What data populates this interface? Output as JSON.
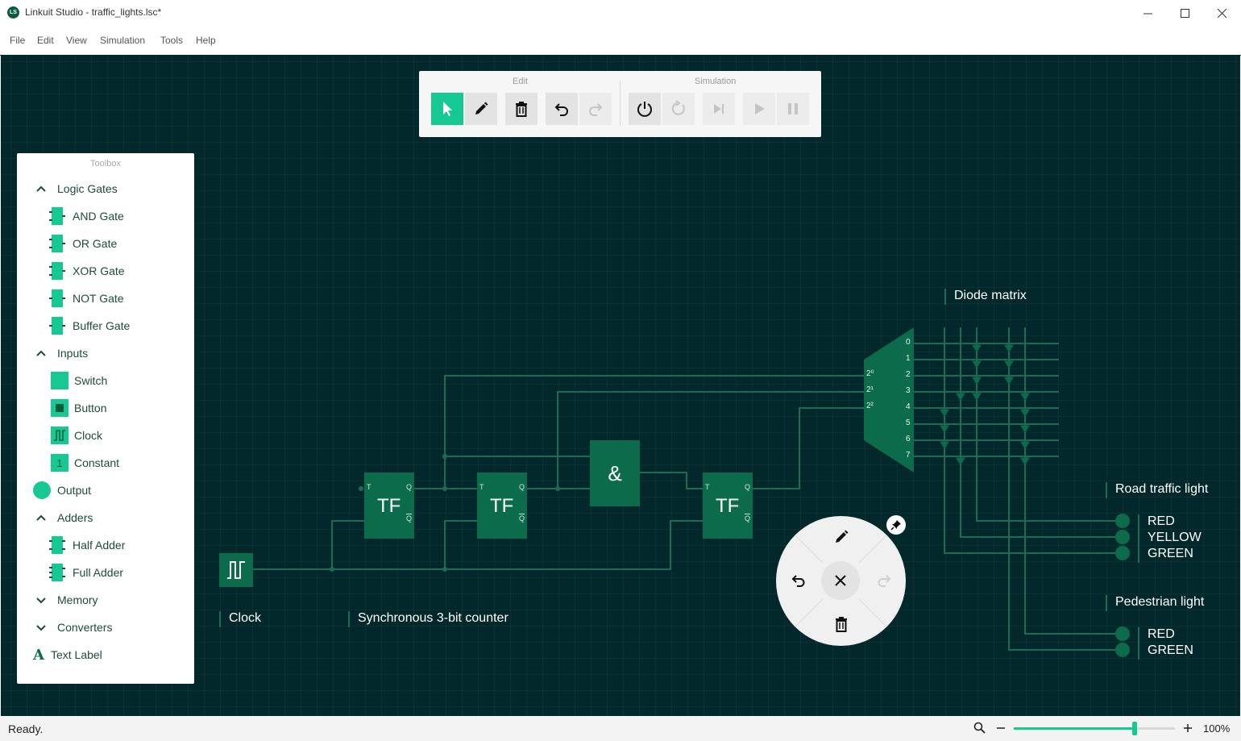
{
  "window": {
    "app_icon": "LS",
    "title": "Linkuit Studio - traffic_lights.lsc*"
  },
  "menu": [
    "File",
    "Edit",
    "View",
    "Simulation",
    "Tools",
    "Help"
  ],
  "toolbar": {
    "edit_label": "Edit",
    "simulation_label": "Simulation",
    "edit_buttons": [
      {
        "name": "select-tool-button",
        "icon": "cursor-arrow-icon",
        "state": "active"
      },
      {
        "name": "wire-tool-button",
        "icon": "pencil-icon",
        "state": "normal"
      },
      {
        "name": "delete-button",
        "icon": "trash-icon",
        "state": "normal"
      },
      {
        "name": "undo-button",
        "icon": "undo-icon",
        "state": "normal"
      },
      {
        "name": "redo-button",
        "icon": "redo-icon",
        "state": "disabled"
      }
    ],
    "simulation_buttons": [
      {
        "name": "power-button",
        "icon": "power-icon",
        "state": "normal"
      },
      {
        "name": "reset-button",
        "icon": "reset-icon",
        "state": "disabled"
      },
      {
        "name": "step-button",
        "icon": "step-icon",
        "state": "disabled"
      },
      {
        "name": "run-button",
        "icon": "play-icon",
        "state": "disabled"
      },
      {
        "name": "pause-button",
        "icon": "pause-icon",
        "state": "disabled"
      }
    ]
  },
  "toolbox": {
    "title": "Toolbox",
    "items": [
      {
        "label": "Logic Gates",
        "kind": "category",
        "icon": "chevron-up-icon"
      },
      {
        "label": "AND Gate",
        "kind": "gate"
      },
      {
        "label": "OR Gate",
        "kind": "gate"
      },
      {
        "label": "XOR Gate",
        "kind": "gate"
      },
      {
        "label": "NOT Gate",
        "kind": "gate"
      },
      {
        "label": "Buffer Gate",
        "kind": "gate"
      },
      {
        "label": "Inputs",
        "kind": "category",
        "icon": "chevron-up-icon"
      },
      {
        "label": "Switch",
        "kind": "switch"
      },
      {
        "label": "Button",
        "kind": "button"
      },
      {
        "label": "Clock",
        "kind": "clock"
      },
      {
        "label": "Constant",
        "kind": "constant",
        "glyph": "1"
      },
      {
        "label": "Output",
        "kind": "output"
      },
      {
        "label": "Adders",
        "kind": "category",
        "icon": "chevron-up-icon"
      },
      {
        "label": "Half Adder",
        "kind": "gate"
      },
      {
        "label": "Full Adder",
        "kind": "gate"
      },
      {
        "label": "Memory",
        "kind": "category",
        "icon": "chevron-down-icon"
      },
      {
        "label": "Converters",
        "kind": "category",
        "icon": "chevron-down-icon"
      },
      {
        "label": "Text Label",
        "kind": "text",
        "glyph": "A"
      }
    ]
  },
  "circuit": {
    "clock_label": "Clock",
    "counter_label": "Synchronous 3-bit counter",
    "diode_label": "Diode matrix",
    "flipflop_text": "TF",
    "flipflop_pins": {
      "t": "T",
      "q": "Q",
      "qbar": "Q"
    },
    "and_symbol": "&",
    "mux_inputs": [
      "2⁰",
      "2¹",
      "2²"
    ],
    "mux_outputs": [
      "0",
      "1",
      "2",
      "3",
      "4",
      "5",
      "6",
      "7"
    ],
    "road_label": "Road traffic light",
    "road_lights": [
      "RED",
      "YELLOW",
      "GREEN"
    ],
    "ped_label": "Pedestrian light",
    "ped_lights": [
      "RED",
      "GREEN"
    ]
  },
  "radial_menu": {
    "icons": [
      "pencil-icon",
      "undo-icon",
      "close-icon",
      "redo-icon",
      "trash-icon",
      "pin-icon"
    ]
  },
  "status": {
    "text": "Ready.",
    "zoom": "100%",
    "zoom_fraction": 0.75
  },
  "colors": {
    "canvas": "#03282b",
    "accent": "#16c993",
    "component": "#0b6b4a",
    "wire": "#1f6b52"
  }
}
